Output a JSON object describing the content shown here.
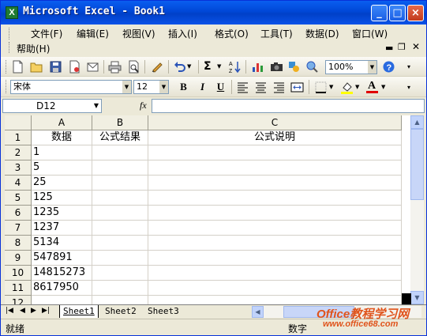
{
  "window": {
    "title": "Microsoft Excel - Book1",
    "app_icon_glyph": "X"
  },
  "menu": {
    "items": [
      "文件(F)",
      "编辑(E)",
      "视图(V)",
      "插入(I)",
      "格式(O)",
      "工具(T)",
      "数据(D)",
      "窗口(W)",
      "帮助(H)"
    ]
  },
  "standard_toolbar": {
    "zoom": "100%",
    "sigma": "Σ",
    "sort": "A↓Z"
  },
  "format_toolbar": {
    "font_name": "宋体",
    "font_size": "12",
    "bold": "B",
    "italic": "I",
    "underline": "U",
    "font_color_letter": "A"
  },
  "formula_bar": {
    "name_box": "D12",
    "fx_label": "fx",
    "formula": ""
  },
  "grid": {
    "columns": [
      "A",
      "B",
      "C"
    ],
    "rows": [
      "1",
      "2",
      "3",
      "4",
      "5",
      "6",
      "7",
      "8",
      "9",
      "10",
      "11",
      "12"
    ],
    "headers_row": [
      "数据",
      "公式结果",
      "公式说明"
    ],
    "column_a_values": [
      "1",
      "5",
      "25",
      "125",
      "1235",
      "1237",
      "5134",
      "547891",
      "14815273",
      "8617950"
    ]
  },
  "sheets": {
    "tabs": [
      "Sheet1",
      "Sheet2",
      "Sheet3"
    ],
    "active": "Sheet1"
  },
  "status": {
    "left": "就绪",
    "num": "数字"
  },
  "watermark": {
    "brand": "Office教程学习网",
    "url": "www.office68.com"
  },
  "colors": {
    "title_bar": "#0a52e8",
    "grid_line": "#d4d0c8",
    "header_bg": "#f1efe2",
    "font_color_bar": "#e00000",
    "fill_bar": "#ffff00"
  }
}
